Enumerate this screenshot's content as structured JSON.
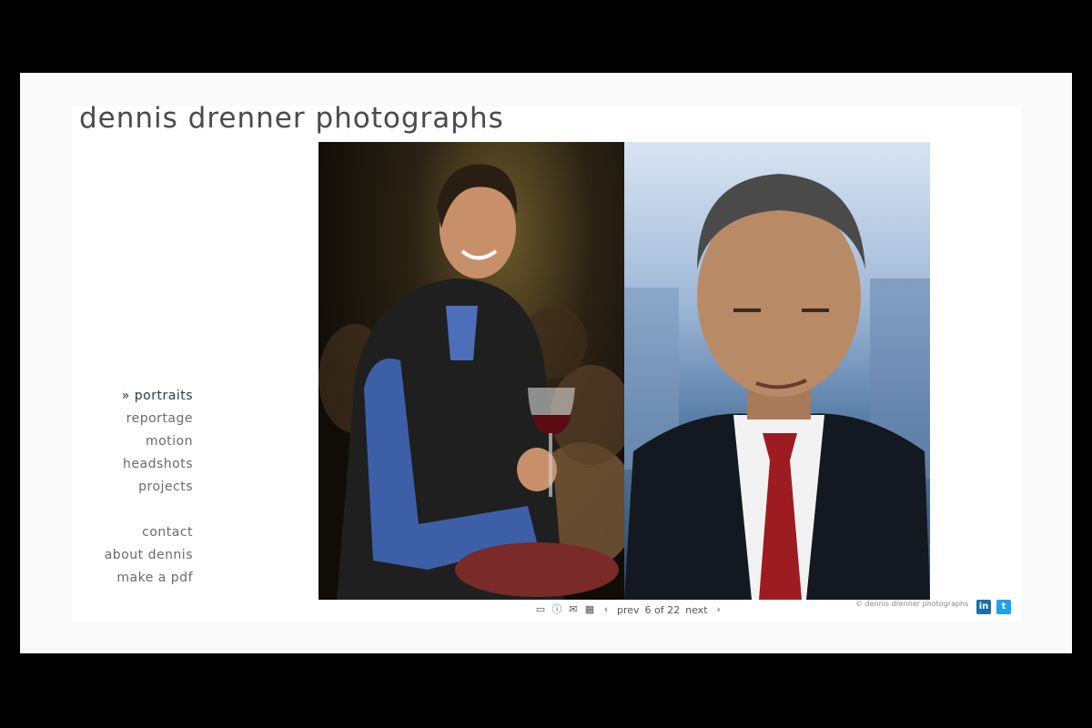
{
  "site": {
    "title": "dennis drenner photographs"
  },
  "nav": {
    "primary": [
      {
        "label": "» portraits",
        "active": true
      },
      {
        "label": "reportage"
      },
      {
        "label": "motion"
      },
      {
        "label": "headshots"
      },
      {
        "label": "projects"
      }
    ],
    "secondary": [
      {
        "label": "contact"
      },
      {
        "label": "about dennis"
      },
      {
        "label": "make a pdf"
      }
    ]
  },
  "gallery": {
    "prev_label": "prev",
    "position": "6 of 22",
    "next_label": "next",
    "icons": [
      "single-view-icon",
      "info-icon",
      "email-icon",
      "grid-view-icon",
      "chevron-left-icon",
      "chevron-right-icon"
    ]
  },
  "footer": {
    "copyright": "© dennis drenner photographs",
    "social": [
      "linkedin-icon",
      "twitter-icon"
    ]
  },
  "colors": {
    "linkedin": "#1c6fa8",
    "twitter": "#1da1f2"
  }
}
